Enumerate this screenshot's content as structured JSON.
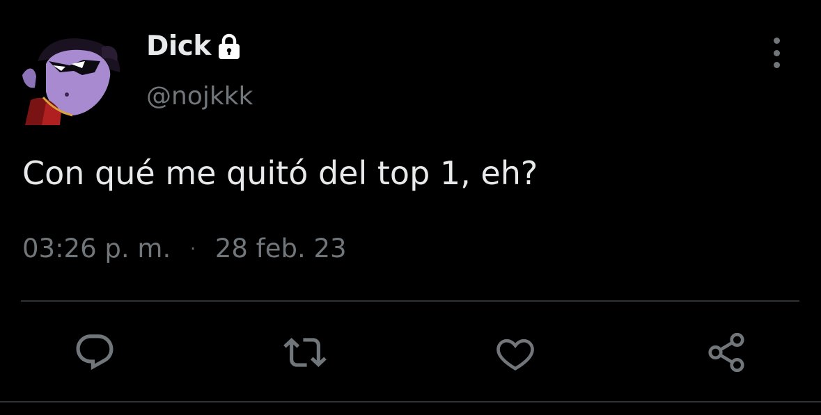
{
  "tweet": {
    "display_name": "Dick",
    "handle": "@nojkkk",
    "text": "Con qué me quitó del top 1, eh?",
    "time": "03:26 p. m.",
    "separator": "·",
    "date": "28 feb. 23",
    "protected": true
  },
  "icons": {
    "lock": "lock-icon",
    "more": "more-vertical-icon",
    "reply": "reply-icon",
    "retweet": "retweet-icon",
    "like": "heart-icon",
    "share": "share-icon"
  },
  "colors": {
    "background": "#000000",
    "primary_text": "#e7e9ea",
    "secondary_text": "#71767b",
    "divider": "#2f3336"
  }
}
